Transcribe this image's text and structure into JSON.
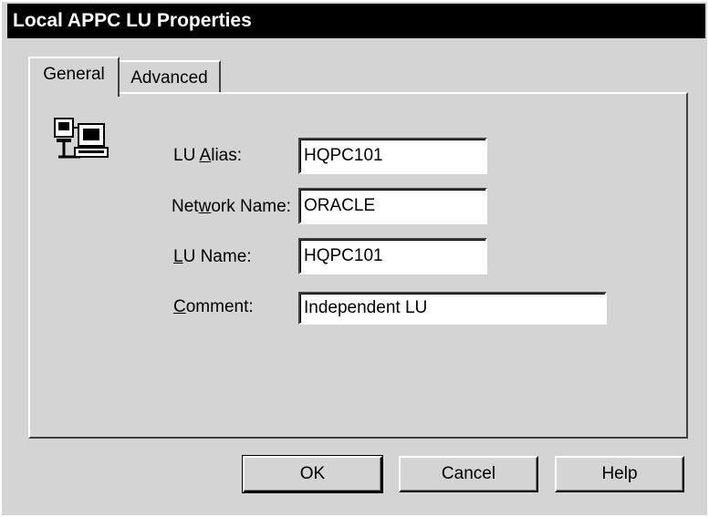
{
  "window": {
    "title": "Local APPC LU Properties"
  },
  "tabs": [
    {
      "label": "General",
      "active": true
    },
    {
      "label": "Advanced",
      "active": false
    }
  ],
  "icon": "network-computer-icon",
  "fields": {
    "lu_alias": {
      "label_pre": "LU ",
      "label_key": "A",
      "label_post": "lias:",
      "value": "HQPC101"
    },
    "network_name": {
      "label_pre": "Net",
      "label_key": "w",
      "label_post": "ork Name:",
      "value": "ORACLE"
    },
    "lu_name": {
      "label_pre": "",
      "label_key": "L",
      "label_post": "U Name:",
      "value": "HQPC101"
    },
    "comment": {
      "label_pre": "",
      "label_key": "C",
      "label_post": "omment:",
      "value": "Independent LU"
    }
  },
  "buttons": {
    "ok": "OK",
    "cancel": "Cancel",
    "help": "Help"
  },
  "colors": {
    "face": "#d4d4d4",
    "title_bar": "#000000",
    "title_text": "#ffffff",
    "field_bg": "#ffffff"
  }
}
